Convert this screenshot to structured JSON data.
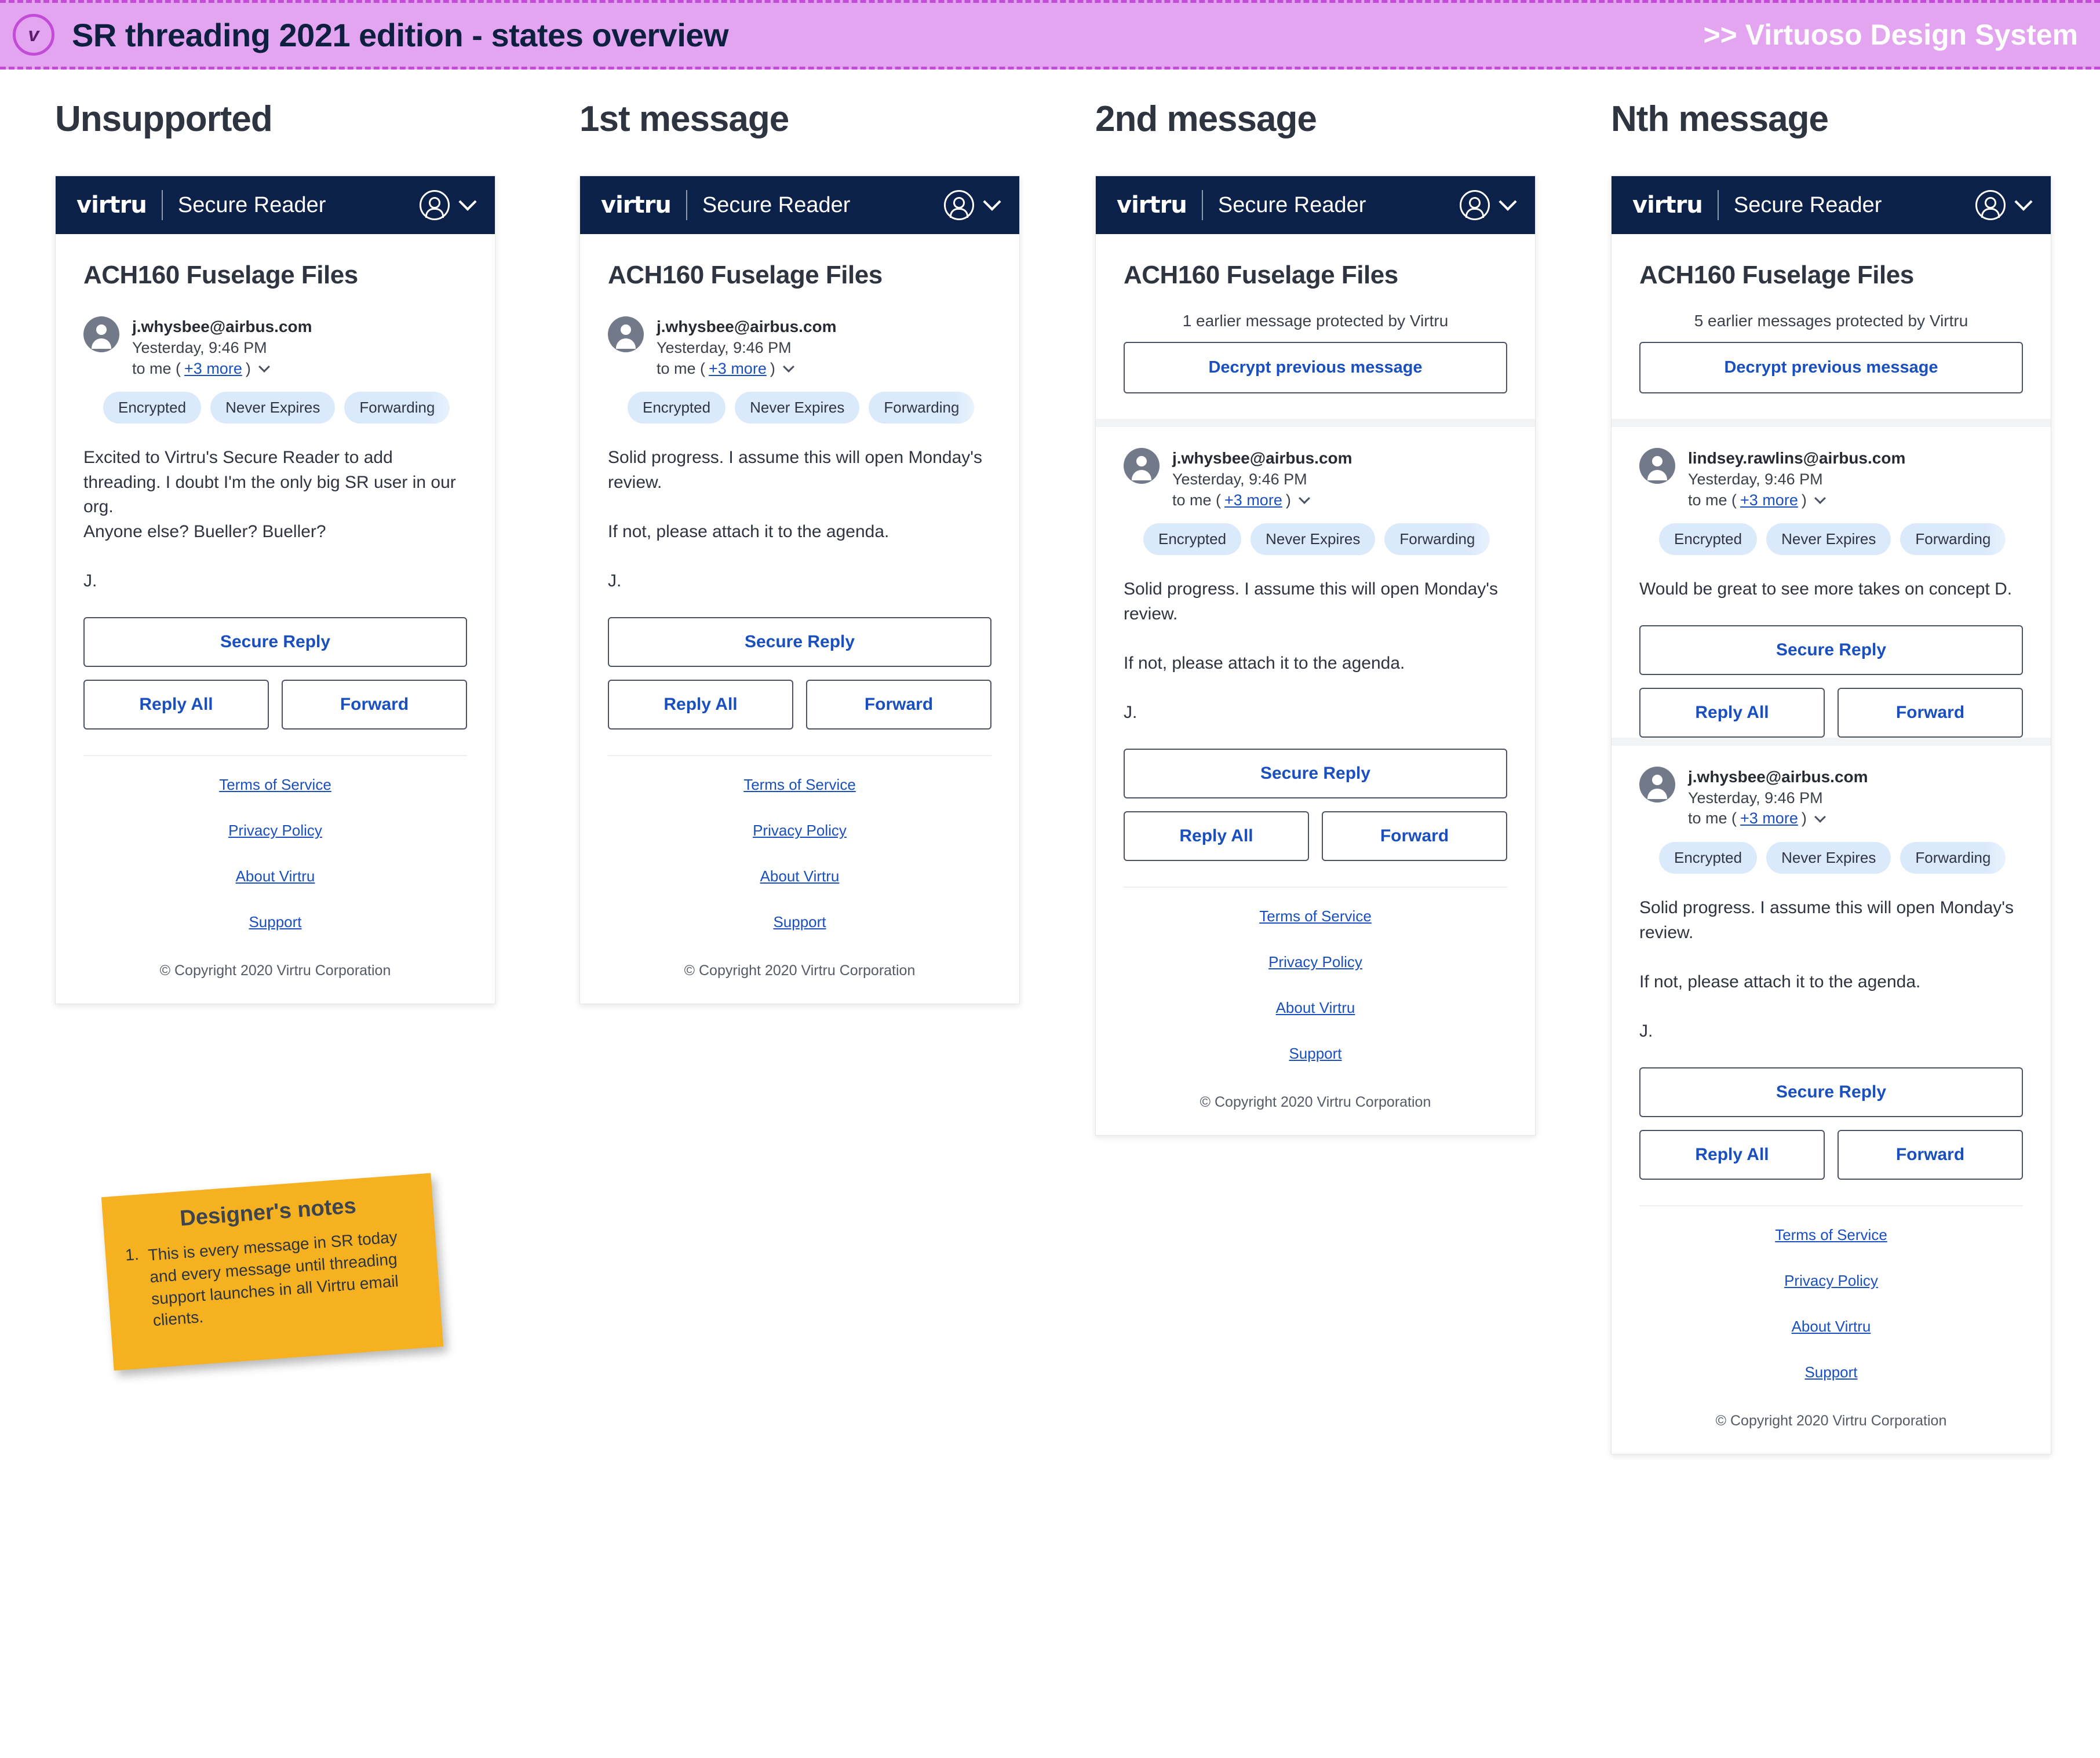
{
  "banner": {
    "logo_glyph": "v",
    "title": "SR threading 2021 edition - states overview",
    "right_label": ">> Virtuoso Design System",
    "bg_color": "#E3A4F0",
    "border_color": "#C24BD8",
    "title_color": "#0E2040",
    "right_color": "#FFFFFF"
  },
  "theme": {
    "navy": "#0B2149",
    "link_blue": "#1A4FBF",
    "badge_bg": "#DBEAFB",
    "note_yellow": "#F5B120",
    "text_dark": "#2E3440"
  },
  "navbar": {
    "logo": "virtru",
    "product": "Secure Reader",
    "avatar_icon": "user-circle-icon",
    "chevron_icon": "chevron-down-icon"
  },
  "footer": {
    "links": [
      "Terms of Service",
      "Privacy Policy",
      "About Virtru",
      "Support"
    ],
    "copyright": "© Copyright 2020 Virtru Corporation"
  },
  "buttons": {
    "secure_reply": "Secure Reply",
    "reply_all": "Reply All",
    "forward": "Forward",
    "decrypt_previous": "Decrypt previous message"
  },
  "badges": [
    "Encrypted",
    "Never Expires",
    "Forwarding"
  ],
  "columns": [
    {
      "heading": "Unsupported",
      "subject": "ACH160 Fuselage Files",
      "earlier_note": null,
      "messages": [
        {
          "email": "j.whysbee@airbus.com",
          "date": "Yesterday, 9:46 PM",
          "to_prefix": "to me  (",
          "to_more": "+3 more",
          "to_suffix": ")",
          "body": "Excited to Virtru's Secure Reader to add threading. I doubt I'm the only big SR user in our org.\nAnyone else? Bueller? Bueller?\n\nJ."
        }
      ]
    },
    {
      "heading": "1st message",
      "subject": "ACH160 Fuselage Files",
      "earlier_note": null,
      "messages": [
        {
          "email": "j.whysbee@airbus.com",
          "date": "Yesterday, 9:46 PM",
          "to_prefix": "to me  (",
          "to_more": "+3 more",
          "to_suffix": ")",
          "body": "Solid progress. I assume this will open Monday's review.\n\nIf not, please attach it to the agenda.\n\nJ."
        }
      ]
    },
    {
      "heading": "2nd message",
      "subject": "ACH160 Fuselage Files",
      "earlier_note": "1 earlier message protected by Virtru",
      "messages": [
        {
          "email": "j.whysbee@airbus.com",
          "date": "Yesterday, 9:46 PM",
          "to_prefix": "to me  (",
          "to_more": "+3 more",
          "to_suffix": ")",
          "body": "Solid progress. I assume this will open Monday's review.\n\nIf not, please attach it to the agenda.\n\nJ."
        }
      ]
    },
    {
      "heading": "Nth message",
      "subject": "ACH160 Fuselage Files",
      "earlier_note": "5 earlier messages protected by Virtru",
      "messages": [
        {
          "email": "lindsey.rawlins@airbus.com",
          "date": "Yesterday, 9:46 PM",
          "to_prefix": "to me  (",
          "to_more": "+3 more",
          "to_suffix": ")",
          "body": "Would be great to see more takes on concept D."
        },
        {
          "email": "j.whysbee@airbus.com",
          "date": "Yesterday, 9:46 PM",
          "to_prefix": "to me  (",
          "to_more": "+3 more",
          "to_suffix": ")",
          "body": "Solid progress. I assume this will open Monday's review.\n\nIf not, please attach it to the agenda.\n\nJ."
        }
      ]
    }
  ],
  "designer_notes": {
    "title": "Designer's notes",
    "items": [
      {
        "num": "1.",
        "text": "This is every message in SR today and every message until threading support launches in all Virtru email clients."
      }
    ]
  }
}
